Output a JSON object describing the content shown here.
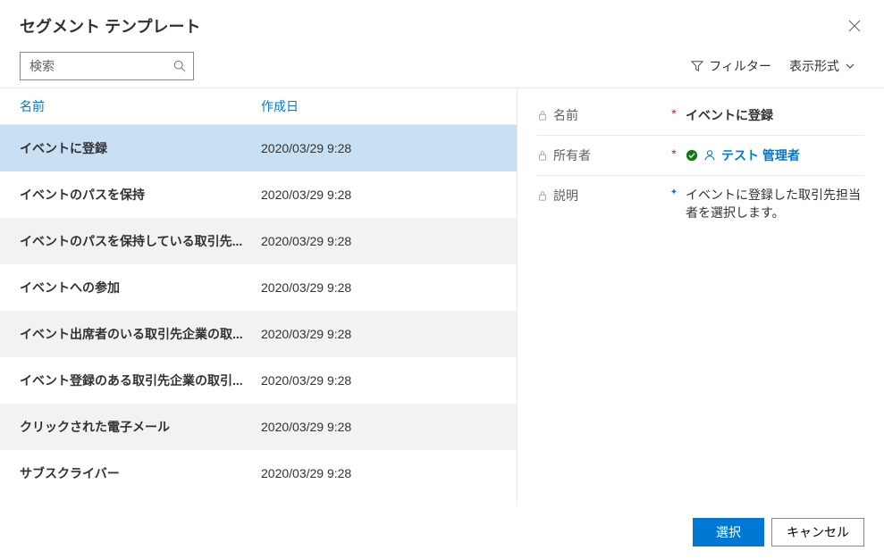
{
  "dialog": {
    "title": "セグメント テンプレート"
  },
  "toolbar": {
    "search_placeholder": "検索",
    "filter_label": "フィルター",
    "display_label": "表示形式"
  },
  "list": {
    "columns": {
      "name": "名前",
      "created": "作成日"
    },
    "rows": [
      {
        "name": "イベントに登録",
        "created": "2020/03/29 9:28",
        "selected": true
      },
      {
        "name": "イベントのパスを保持",
        "created": "2020/03/29 9:28",
        "selected": false
      },
      {
        "name": "イベントのパスを保持している取引先...",
        "created": "2020/03/29 9:28",
        "selected": false
      },
      {
        "name": "イベントへの参加",
        "created": "2020/03/29 9:28",
        "selected": false
      },
      {
        "name": "イベント出席者のいる取引先企業の取...",
        "created": "2020/03/29 9:28",
        "selected": false
      },
      {
        "name": "イベント登録のある取引先企業の取引...",
        "created": "2020/03/29 9:28",
        "selected": false
      },
      {
        "name": "クリックされた電子メール",
        "created": "2020/03/29 9:28",
        "selected": false
      },
      {
        "name": "サブスクライバー",
        "created": "2020/03/29 9:28",
        "selected": false
      }
    ]
  },
  "detail": {
    "fields": {
      "name": {
        "label": "名前",
        "value": "イベントに登録",
        "required": true
      },
      "owner": {
        "label": "所有者",
        "value": "テスト 管理者",
        "required": true
      },
      "description": {
        "label": "説明",
        "value": "イベントに登録した取引先担当者を選択します。",
        "recommended": true
      }
    }
  },
  "footer": {
    "select": "選択",
    "cancel": "キャンセル"
  }
}
